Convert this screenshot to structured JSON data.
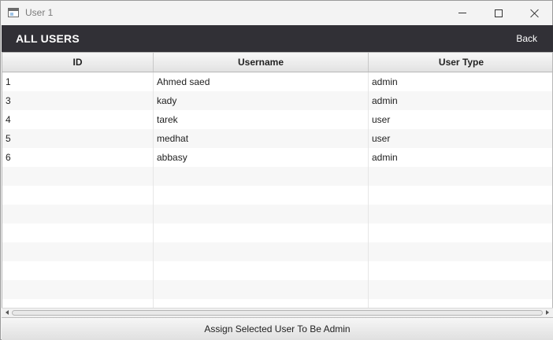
{
  "window": {
    "title": "User 1",
    "icon": "app-window-icon",
    "controls": [
      "minimize-icon",
      "maximize-icon",
      "close-icon"
    ]
  },
  "header": {
    "title": "ALL USERS",
    "back_label": "Back",
    "background_color": "#313036"
  },
  "table": {
    "columns": [
      "ID",
      "Username",
      "User Type"
    ],
    "rows": [
      {
        "id": "1",
        "username": "Ahmed saed",
        "user_type": "admin"
      },
      {
        "id": "3",
        "username": "kady",
        "user_type": "admin"
      },
      {
        "id": "4",
        "username": "tarek",
        "user_type": "user"
      },
      {
        "id": "5",
        "username": "medhat",
        "user_type": "user"
      },
      {
        "id": "6",
        "username": "abbasy",
        "user_type": "admin"
      },
      {
        "id": "",
        "username": "",
        "user_type": ""
      },
      {
        "id": "",
        "username": "",
        "user_type": ""
      },
      {
        "id": "",
        "username": "",
        "user_type": ""
      },
      {
        "id": "",
        "username": "",
        "user_type": ""
      },
      {
        "id": "",
        "username": "",
        "user_type": ""
      },
      {
        "id": "",
        "username": "",
        "user_type": ""
      },
      {
        "id": "",
        "username": "",
        "user_type": ""
      },
      {
        "id": "",
        "username": "",
        "user_type": ""
      }
    ]
  },
  "footer": {
    "assign_label": "Assign Selected User To Be Admin"
  }
}
